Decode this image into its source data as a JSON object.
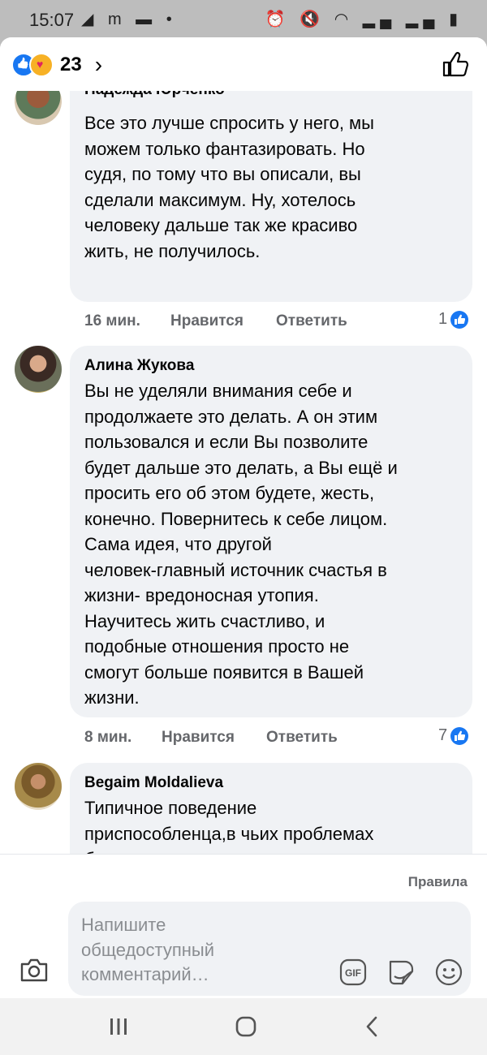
{
  "status_bar": {
    "time": "15:07",
    "left_icons": "◢ m ▬ •",
    "right_icons": "⏰ 🔇 ◠ ▂▄ ▂▄ ▮"
  },
  "header": {
    "reaction_count": "23",
    "chevron": "›"
  },
  "comments": [
    {
      "author": "Надежда Юрченко",
      "lines": "Все это лучше спросить у него, мы\nможем только фантазировать. Но\nсудя, по тому что вы описали, вы\nсделали максимум. Ну, хотелось\nчеловеку дальше так же красиво\nжить, не получилось.",
      "time": "16 мин.",
      "like_label": "Нравится",
      "reply_label": "Ответить",
      "likes": "1"
    },
    {
      "author": "Алина Жукова",
      "lines": "Вы не уделяли внимания себе и\nпродолжаете это делать. А он этим\nпользовался и если Вы позволите\nбудет дальше это делать, а Вы ещё и\nпросить его об этом будете, жесть,\nконечно. Повернитесь к себе лицом.\nСама идея, что другой\nчеловек-главный источник счастья в\nжизни- вредоносная утопия.\nНаучитесь жить счастливо, и\nподобные отношения просто не\nсмогут больше появится в Вашей\nжизни.",
      "time": "8 мин.",
      "like_label": "Нравится",
      "reply_label": "Ответить",
      "likes": "7"
    },
    {
      "author": "Begaim Moldalieva",
      "lines": "Типичное поведение\nприспособленца,в чьих проблемах\nбудет виноват кто то ,но только не\nон.Вы \"переболели \"им,а это"
    }
  ],
  "footer": {
    "rules_label": "Правила",
    "placeholder": "Напишите\nобщедоступный\nкомментарий…"
  },
  "colors": {
    "accent": "#1877f2",
    "bubble": "#f0f2f5",
    "meta_text": "#65676b"
  },
  "icons": [
    "like-icon",
    "care-icon",
    "chevron-right-icon",
    "thumbs-up-icon",
    "camera-icon",
    "gif-icon",
    "sticker-icon",
    "emoji-icon",
    "nav-recent-icon",
    "nav-home-icon",
    "nav-back-icon"
  ]
}
